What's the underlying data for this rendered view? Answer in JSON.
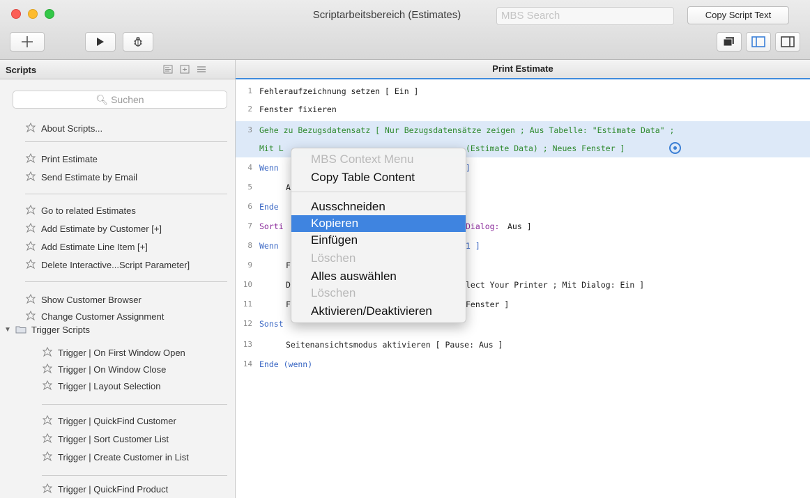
{
  "window": {
    "title": "Scriptarbeitsbereich (Estimates)",
    "mbs_search_placeholder": "MBS Search",
    "copy_script_text_label": "Copy Script Text"
  },
  "toolbar": {
    "add_icon": "plus-icon",
    "run_icon": "play-icon",
    "debug_icon": "bug-icon"
  },
  "sidebar": {
    "title": "Scripts",
    "search_placeholder": "Suchen",
    "items": [
      {
        "label": "About Scripts..."
      },
      {
        "label": "Print Estimate"
      },
      {
        "label": "Send Estimate by Email"
      },
      {
        "label": "Go to related Estimates"
      },
      {
        "label": "Add Estimate by Customer [+]"
      },
      {
        "label": "Add Estimate Line Item [+]"
      },
      {
        "label": "Delete Interactive...Script Parameter]"
      },
      {
        "label": "Show Customer Browser"
      },
      {
        "label": "Change Customer Assignment"
      }
    ],
    "folder": {
      "label": "Trigger Scripts",
      "items": [
        {
          "label": "Trigger | On First Window Open"
        },
        {
          "label": "Trigger | On Window Close"
        },
        {
          "label": "Trigger | Layout Selection"
        },
        {
          "label": "Trigger | QuickFind Customer"
        },
        {
          "label": "Trigger | Sort Customer List"
        },
        {
          "label": "Trigger | Create Customer in List"
        },
        {
          "label": "Trigger | QuickFind Product"
        }
      ]
    }
  },
  "editor": {
    "title": "Print Estimate",
    "lines": [
      {
        "num": "1",
        "text": "Fehleraufzeichnung setzen [ Ein ]"
      },
      {
        "num": "2",
        "text": "Fenster fixieren"
      },
      {
        "num": "3",
        "text": "Gehe zu Bezugsdatensatz [ Nur Bezugsdatensätze zeigen ; Aus Tabelle: \"Estimate Data\" ;"
      },
      {
        "num": "",
        "text_a": "Mit L",
        "text_b": "(Estimate Data) ; Neues Fenster ]"
      },
      {
        "num": "4",
        "text_a": "Wenn",
        "text_b": "]"
      },
      {
        "num": "5",
        "text": "A"
      },
      {
        "num": "6",
        "text": "Ende"
      },
      {
        "num": "7",
        "text_a": "Sorti",
        "text_b": "Dialog:",
        "text_c": "Aus ]"
      },
      {
        "num": "8",
        "text_a": "Wenn",
        "text_b": "1 ]"
      },
      {
        "num": "9",
        "text": "F"
      },
      {
        "num": "10",
        "text_a": "D",
        "text_b": "lect Your Printer ; Mit Dialog: Ein ]"
      },
      {
        "num": "11",
        "text_a": "F",
        "text_b": "Fenster ]"
      },
      {
        "num": "12",
        "text": "Sonst"
      },
      {
        "num": "13",
        "text": "Seitenansichtsmodus aktivieren [ Pause: Aus ]"
      },
      {
        "num": "14",
        "text": "Ende (wenn)"
      }
    ]
  },
  "context_menu": {
    "header": "MBS Context Menu",
    "copy_table": "Copy Table Content",
    "cut": "Ausschneiden",
    "copy": "Kopieren",
    "paste": "Einfügen",
    "delete1": "Löschen",
    "select_all": "Alles auswählen",
    "delete2": "Löschen",
    "toggle": "Aktivieren/Deaktivieren"
  },
  "colors": {
    "highlight": "#3f84e0",
    "accent_line": "#3f8bdc",
    "code_green": "#2f8a2f",
    "code_blue": "#3a67c4",
    "code_purple": "#8b2b9b"
  }
}
